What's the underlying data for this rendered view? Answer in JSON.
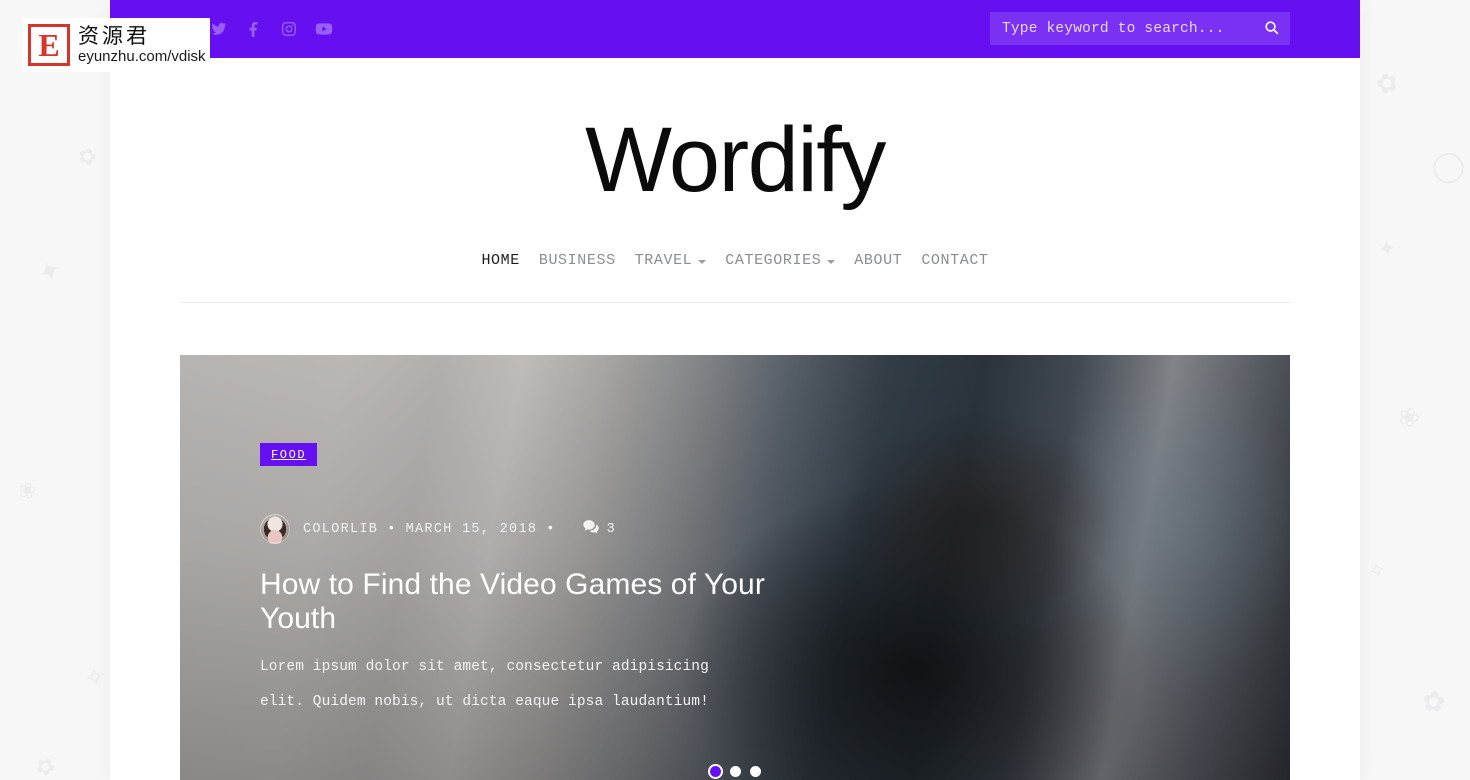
{
  "site": {
    "brand": "Wordify",
    "accent_color": "#6610f2",
    "card_bg": "#ffffff",
    "page_bg": "#f7f7f8"
  },
  "topbar": {
    "social": [
      {
        "name": "twitter-icon",
        "label": "Twitter"
      },
      {
        "name": "facebook-icon",
        "label": "Facebook"
      },
      {
        "name": "instagram-icon",
        "label": "Instagram"
      },
      {
        "name": "youtube-icon",
        "label": "YouTube"
      }
    ],
    "search": {
      "placeholder": "Type keyword to search...",
      "value": "",
      "button_icon": "search-icon"
    }
  },
  "nav": {
    "items": [
      {
        "label": "HOME",
        "active": true,
        "caret": false
      },
      {
        "label": "BUSINESS",
        "active": false,
        "caret": false
      },
      {
        "label": "TRAVEL",
        "active": false,
        "caret": true
      },
      {
        "label": "CATEGORIES",
        "active": false,
        "caret": true
      },
      {
        "label": "ABOUT",
        "active": false,
        "caret": false
      },
      {
        "label": "CONTACT",
        "active": false,
        "caret": false
      }
    ]
  },
  "hero": {
    "category": "FOOD",
    "author": "COLORLIB",
    "separator": "•",
    "date": "MARCH 15, 2018",
    "comment_icon": "comment-icon",
    "comment_count": "3",
    "title": "How to Find the Video Games of Your Youth",
    "excerpt": "Lorem ipsum dolor sit amet, consectetur adipisicing elit. Quidem nobis, ut dicta eaque ipsa laudantium!",
    "slides": [
      {
        "active": true
      },
      {
        "active": false
      },
      {
        "active": false
      }
    ]
  },
  "watermark": {
    "mark": "E",
    "cn": "资源君",
    "url": "eyunzhu.com/vdisk"
  }
}
